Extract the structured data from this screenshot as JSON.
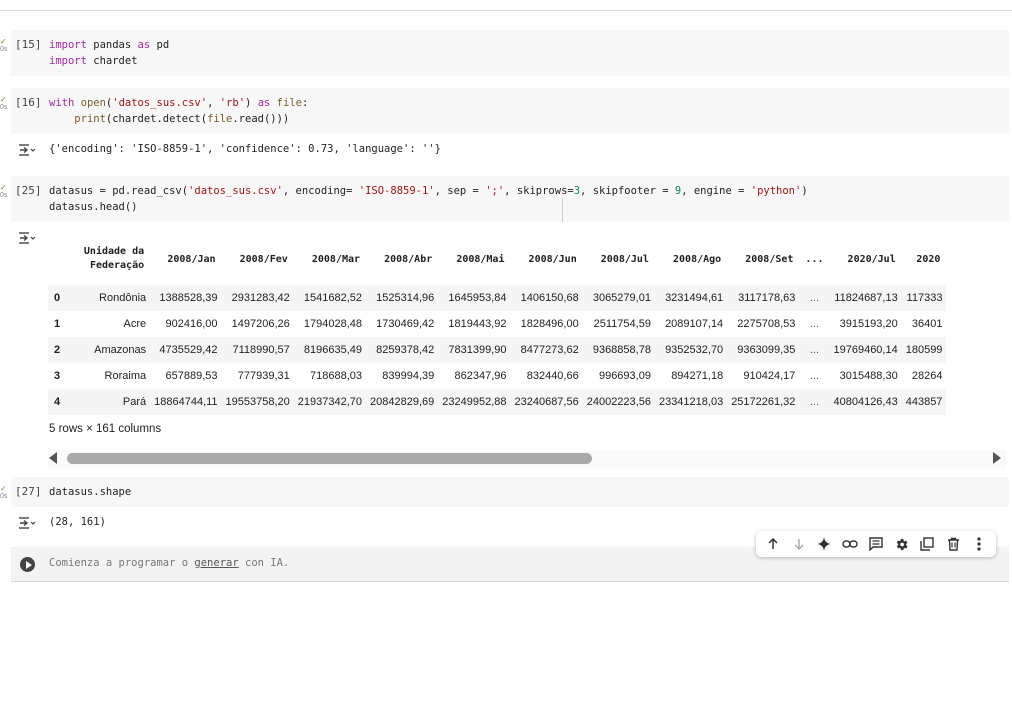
{
  "cells": [
    {
      "count": "[15]",
      "code": [
        "import pandas as pd",
        "import chardet"
      ]
    },
    {
      "count": "[16]",
      "code": [
        "with open('datos_sus.csv', 'rb') as file:",
        "    print(chardet.detect(file.read()))"
      ],
      "output": "{'encoding': 'ISO-8859-1', 'confidence': 0.73, 'language': ''}"
    },
    {
      "count": "[25]",
      "code": [
        "datasus = pd.read_csv('datos_sus.csv', encoding= 'ISO-8859-1', sep = ';', skiprows=3, skipfooter = 9, engine = 'python')",
        "datasus.head()"
      ]
    },
    {
      "count": "[27]",
      "code": [
        "datasus.shape"
      ],
      "output": "(28, 161)"
    }
  ],
  "run_mark": {
    "check": "✓",
    "label": "0s"
  },
  "dataframe": {
    "columns": [
      "Unidade da Federação",
      "2008/Jan",
      "2008/Fev",
      "2008/Mar",
      "2008/Abr",
      "2008/Mai",
      "2008/Jun",
      "2008/Jul",
      "2008/Ago",
      "2008/Set",
      "...",
      "2020/Jul",
      "2020"
    ],
    "rows": [
      [
        "0",
        "Rondônia",
        "1388528,39",
        "2931283,42",
        "1541682,52",
        "1525314,96",
        "1645953,84",
        "1406150,68",
        "3065279,01",
        "3231494,61",
        "3117178,63",
        "...",
        "11824687,13",
        "117333"
      ],
      [
        "1",
        "Acre",
        "902416,00",
        "1497206,26",
        "1794028,48",
        "1730469,42",
        "1819443,92",
        "1828496,00",
        "2511754,59",
        "2089107,14",
        "2275708,53",
        "...",
        "3915193,20",
        "36401"
      ],
      [
        "2",
        "Amazonas",
        "4735529,42",
        "7118990,57",
        "8196635,49",
        "8259378,42",
        "7831399,90",
        "8477273,62",
        "9368858,78",
        "9352532,70",
        "9363099,35",
        "...",
        "19769460,14",
        "180599"
      ],
      [
        "3",
        "Roraima",
        "657889,53",
        "777939,31",
        "718688,03",
        "839994,39",
        "862347,96",
        "832440,66",
        "996693,09",
        "894271,18",
        "910424,17",
        "...",
        "3015488,30",
        "28264"
      ],
      [
        "4",
        "Pará",
        "18864744,11",
        "19553758,20",
        "21937342,70",
        "20842829,69",
        "23249952,88",
        "23240687,56",
        "24002223,56",
        "23341218,03",
        "25172261,32",
        "...",
        "40804126,43",
        "443857"
      ]
    ],
    "caption": "5 rows × 161 columns"
  },
  "new_cell": {
    "placeholder_before": "Comienza a programar o ",
    "placeholder_link": "generar",
    "placeholder_after": " con IA."
  },
  "toolbar": {
    "icons": [
      "arrow-up-icon",
      "arrow-down-icon",
      "sparkle-icon",
      "link-icon",
      "comment-icon",
      "gear-icon",
      "mirror-cell-icon",
      "trash-icon",
      "more-vert-icon"
    ]
  }
}
